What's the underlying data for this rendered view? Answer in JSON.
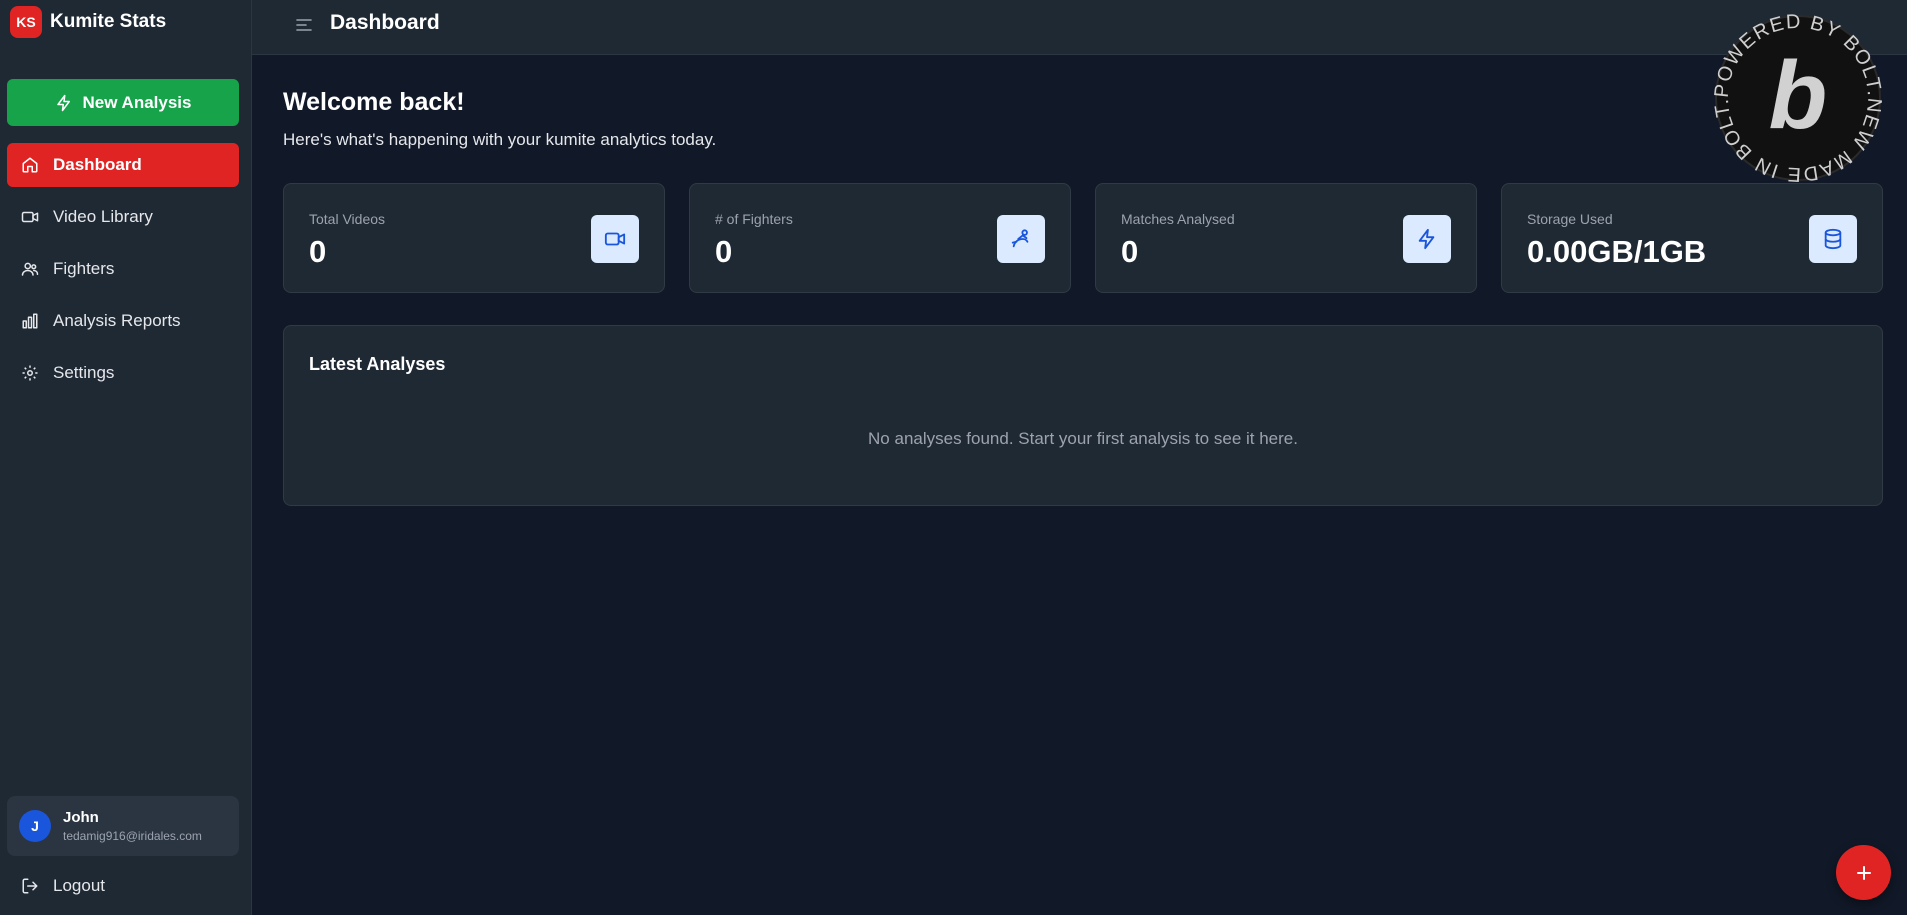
{
  "brand": {
    "logo_text": "KS",
    "name": "Kumite Stats"
  },
  "sidebar": {
    "new_analysis_label": "New Analysis",
    "items": [
      {
        "label": "Dashboard",
        "icon": "home-icon",
        "active": true
      },
      {
        "label": "Video Library",
        "icon": "video-icon",
        "active": false
      },
      {
        "label": "Fighters",
        "icon": "users-icon",
        "active": false
      },
      {
        "label": "Analysis Reports",
        "icon": "bar-chart-icon",
        "active": false
      },
      {
        "label": "Settings",
        "icon": "gear-icon",
        "active": false
      }
    ],
    "user": {
      "initial": "J",
      "name": "John",
      "email": "tedamig916@iridales.com"
    },
    "logout_label": "Logout"
  },
  "header": {
    "title": "Dashboard",
    "menu_icon": "menu-icon"
  },
  "main": {
    "welcome": "Welcome back!",
    "subtitle": "Here's what's happening with your kumite analytics today.",
    "stats": [
      {
        "label": "Total Videos",
        "value": "0",
        "icon": "video-icon"
      },
      {
        "label": "# of Fighters",
        "value": "0",
        "icon": "fighter-icon"
      },
      {
        "label": "Matches Analysed",
        "value": "0",
        "icon": "lightning-icon"
      },
      {
        "label": "Storage Used",
        "value": "0.00GB/1GB",
        "icon": "database-icon"
      }
    ],
    "latest": {
      "title": "Latest Analyses",
      "empty_message": "No analyses found. Start your first analysis to see it here."
    }
  },
  "badge": {
    "text": "POWERED BY BOLT.NEW MADE IN BOLT.NEW ",
    "letter": "b"
  },
  "fab": {
    "icon": "plus-icon"
  },
  "colors": {
    "background": "#111827",
    "panel": "#1f2933",
    "accent_red": "#e02424",
    "accent_green": "#16a34a",
    "icon_blue": "#1a56db",
    "icon_bg": "#dbeafe"
  }
}
